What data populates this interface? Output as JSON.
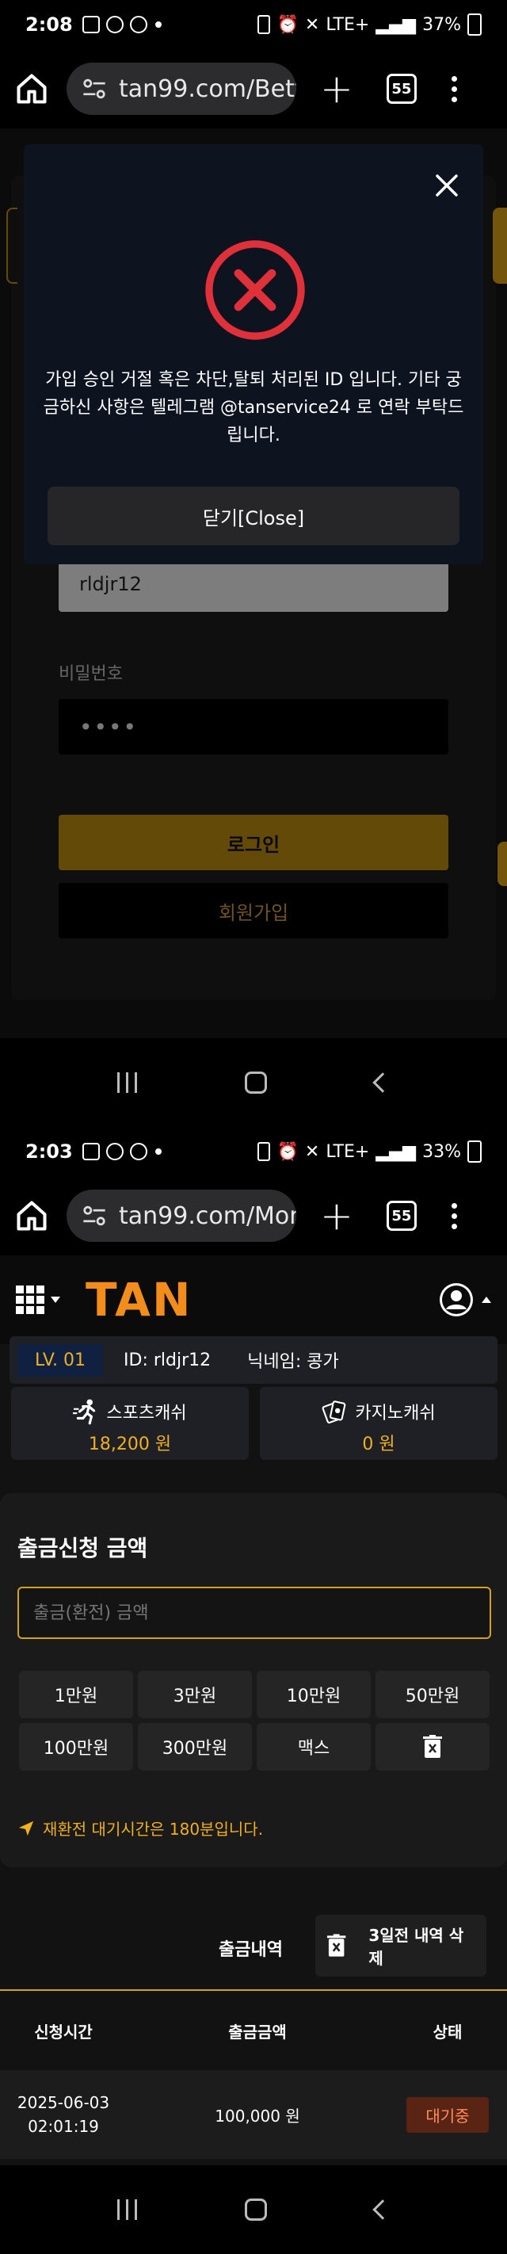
{
  "screen1": {
    "status": {
      "time": "2:08",
      "network": "LTE+",
      "battery": "37%"
    },
    "url": "tan99.com/Bettin",
    "tab_count": "55",
    "login": {
      "id_value": "rldjr12",
      "password_label": "비밀번호",
      "password_value": "••••",
      "login_label": "로그인",
      "join_label": "회원가입"
    },
    "modal": {
      "message": "가입 승인 거절 혹은 차단,탈퇴 처리된 ID 입니다. 기타 궁금하신 사항은 텔레그램 @tanservice24 로 연락 부탁드립니다.",
      "button": "닫기[Close]"
    }
  },
  "screen2": {
    "status": {
      "time": "2:03",
      "network": "LTE+",
      "battery": "33%"
    },
    "url": "tan99.com/Mone",
    "tab_count": "55",
    "logo": "TAN",
    "account": {
      "level": "LV. 01",
      "id": "ID: rldjr12",
      "nickname": "닉네임: 콩가"
    },
    "cash": [
      {
        "label": "스포츠캐쉬",
        "value": "18,200 원",
        "icon": "runner-icon"
      },
      {
        "label": "카지노캐쉬",
        "value": "0 원",
        "icon": "cards-icon"
      }
    ],
    "withdraw": {
      "title": "출금신청 금액",
      "placeholder": "출금(환전) 금액",
      "amounts": [
        "1만원",
        "3만원",
        "10만원",
        "50만원",
        "100만원",
        "300만원",
        "맥스"
      ],
      "notice": "재환전 대기시간은 180분입니다."
    },
    "history": {
      "title": "출금내역",
      "delete_label": "3일전 내역 삭제",
      "columns": [
        "신청시간",
        "출금금액",
        "상태"
      ],
      "rows": [
        {
          "date": "2025-06-03",
          "time": "02:01:19",
          "amount": "100,000 원",
          "status": "대기중"
        }
      ]
    }
  }
}
